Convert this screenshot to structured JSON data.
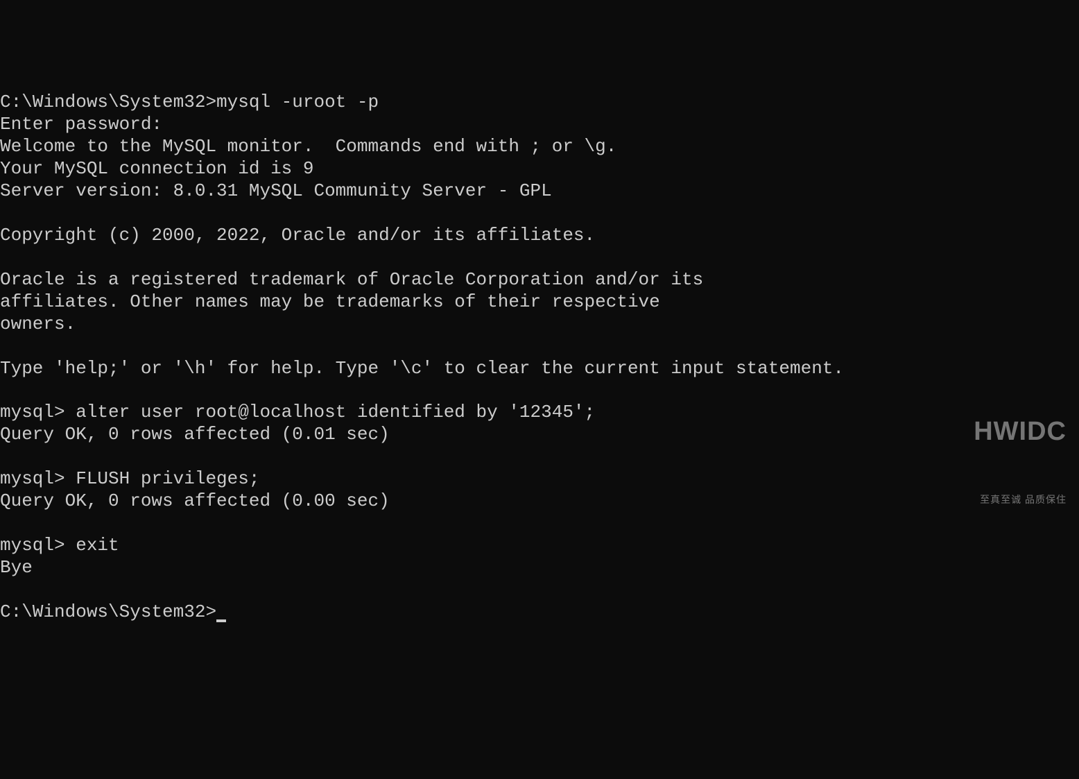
{
  "lines": {
    "l0": "C:\\Windows\\System32>mysql -uroot -p",
    "l1": "Enter password:",
    "l2": "Welcome to the MySQL monitor.  Commands end with ; or \\g.",
    "l3": "Your MySQL connection id is 9",
    "l4": "Server version: 8.0.31 MySQL Community Server - GPL",
    "l5": "",
    "l6": "Copyright (c) 2000, 2022, Oracle and/or its affiliates.",
    "l7": "",
    "l8": "Oracle is a registered trademark of Oracle Corporation and/or its",
    "l9": "affiliates. Other names may be trademarks of their respective",
    "l10": "owners.",
    "l11": "",
    "l12": "Type 'help;' or '\\h' for help. Type '\\c' to clear the current input statement.",
    "l13": "",
    "l14": "mysql> alter user root@localhost identified by '12345';",
    "l15": "Query OK, 0 rows affected (0.01 sec)",
    "l16": "",
    "l17": "mysql> FLUSH privileges;",
    "l18": "Query OK, 0 rows affected (0.00 sec)",
    "l19": "",
    "l20": "mysql> exit",
    "l21": "Bye",
    "l22": "",
    "l23": "C:\\Windows\\System32>"
  },
  "watermark": {
    "logo": "HWIDC",
    "tagline": "至真至诚 品质保住"
  }
}
